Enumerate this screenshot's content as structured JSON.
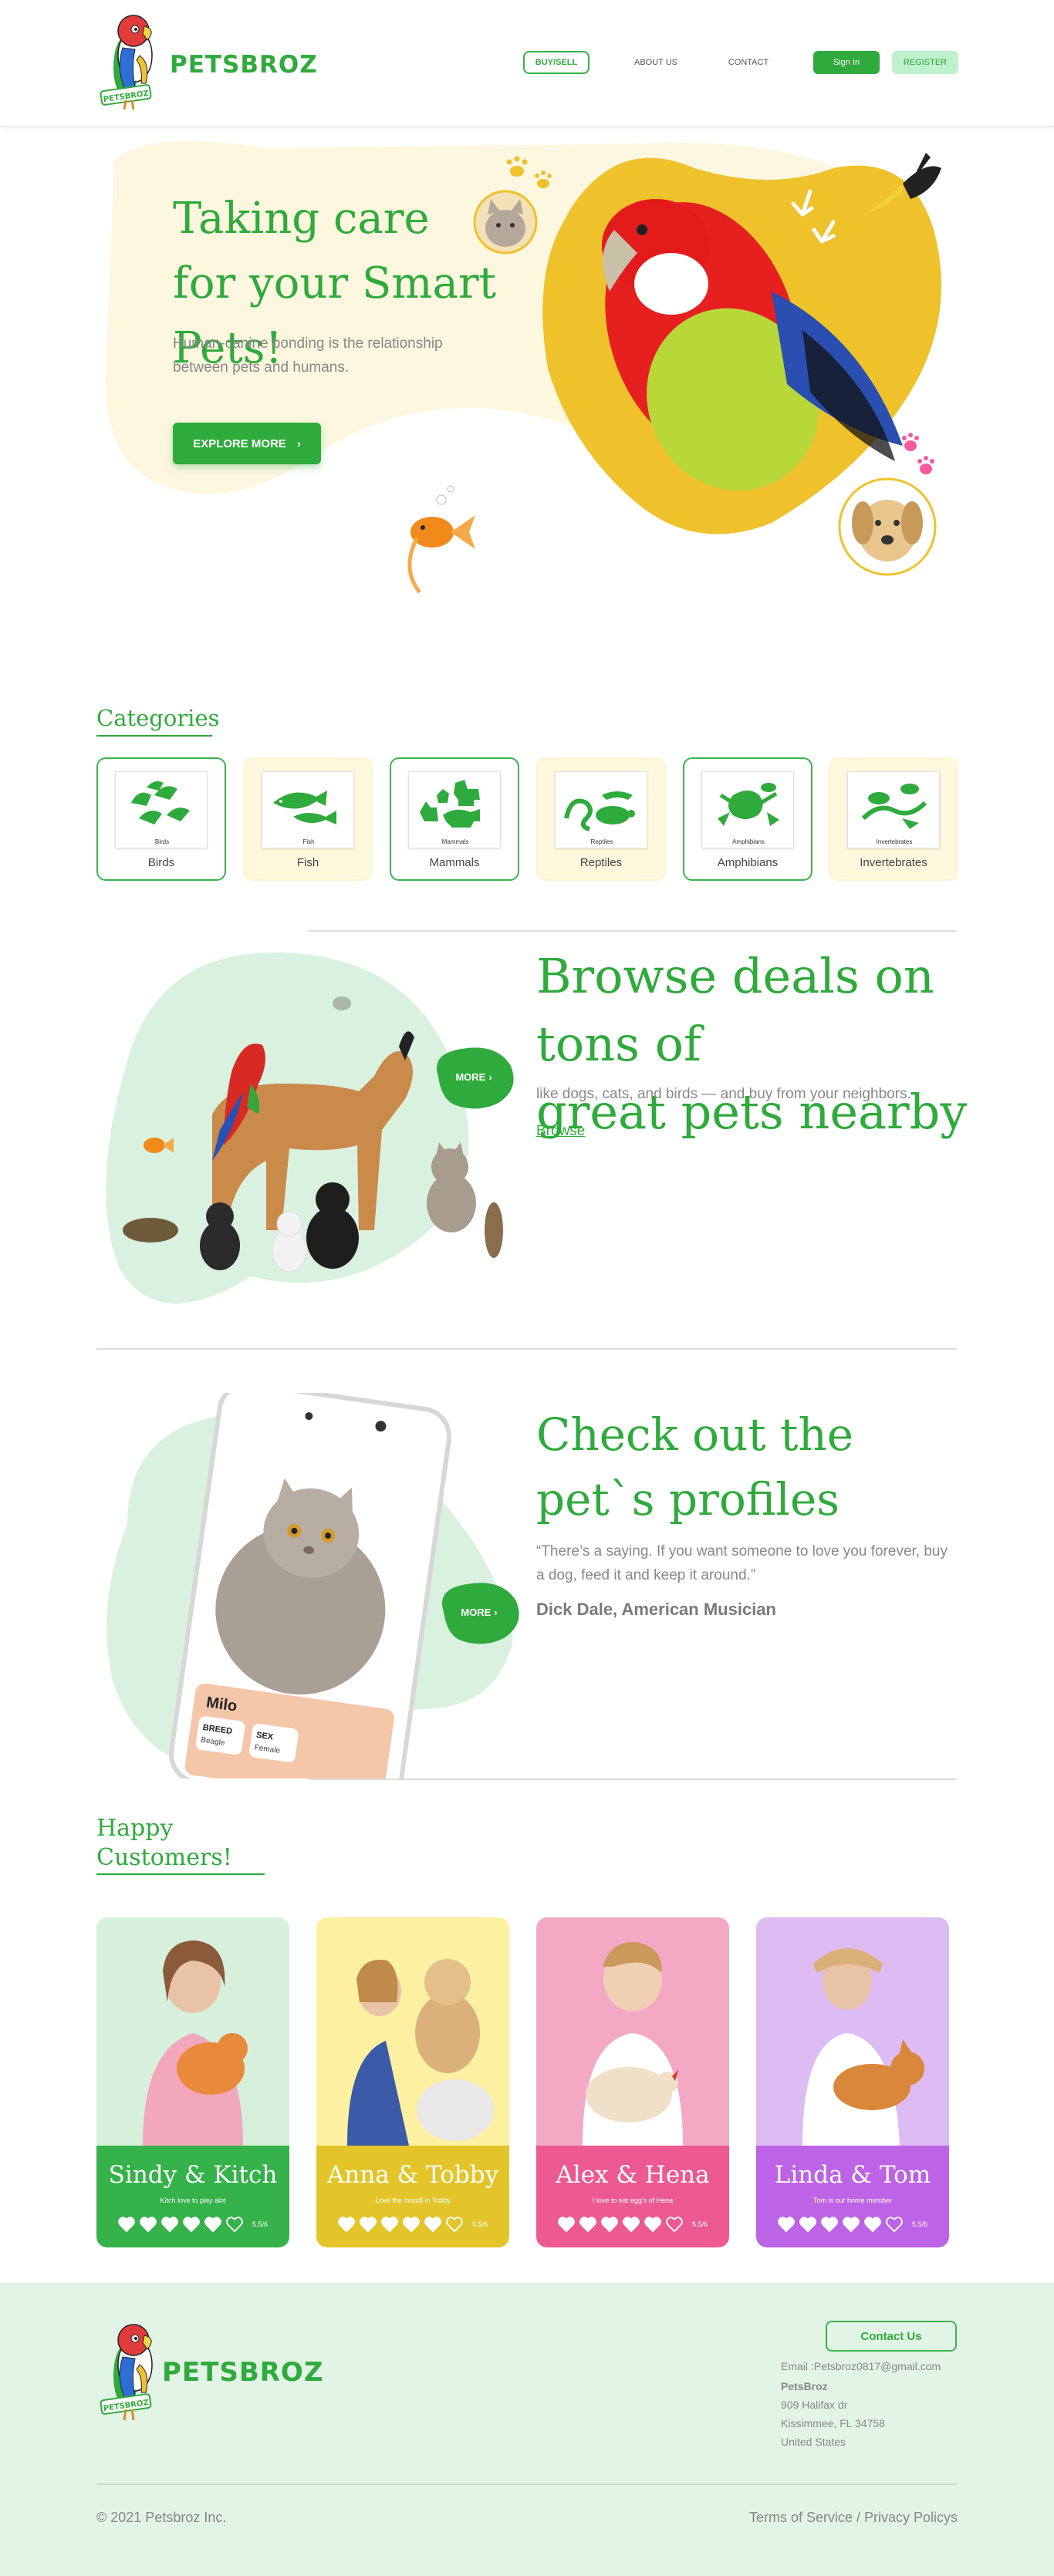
{
  "brand": {
    "name": "PETSBROZ",
    "logo_badge": "PETSBROZ",
    "primary_color": "#2faa3c",
    "accent_yellow": "#f0c030"
  },
  "nav": {
    "buy_sell": "BUY/SELL",
    "about": "ABOUT US",
    "contact": "CONTACT",
    "sign_in": "Sign In",
    "register": "REGISTER"
  },
  "hero": {
    "title_line1": "Taking care",
    "title_line2": "for your Smart Pets!",
    "description": "Human-canine bonding is the relationship between pets and humans.",
    "cta": "EXPLORE MORE",
    "cta_icon": "chevron-right-icon"
  },
  "categories": {
    "title": "Categories",
    "items": [
      {
        "label": "Birds",
        "thumb_label": "Birds",
        "icon": "birds-icon"
      },
      {
        "label": "Fish",
        "thumb_label": "Fish",
        "icon": "fish-icon"
      },
      {
        "label": "Mammals",
        "thumb_label": "Mammals",
        "icon": "mammals-icon"
      },
      {
        "label": "Reptiles",
        "thumb_label": "Reptiles",
        "icon": "reptiles-icon"
      },
      {
        "label": "Amphibians",
        "thumb_label": "Amphibians",
        "icon": "amphibians-icon"
      },
      {
        "label": "Invertebrates",
        "thumb_label": "Invertebrates",
        "icon": "invertebrates-icon"
      }
    ]
  },
  "browse": {
    "title_line1": "Browse deals on tons of",
    "title_line2": "great pets nearby",
    "description": "like dogs, cats, and birds — and buy from your neighbors.",
    "link": "Browse",
    "more": "MORE"
  },
  "profiles": {
    "title_line1": "Check out the",
    "title_line2": "pet`s profiles",
    "quote": "“There’s a saying. If you want someone to love you forever, buy a dog, feed it and keep it around.”",
    "author": "Dick Dale, American Musician",
    "more": "MORE",
    "phone": {
      "pet_name": "Milo",
      "breed_label": "BREED",
      "breed_value": "Beagle",
      "sex_label": "SEX",
      "sex_value": "Female"
    }
  },
  "customers": {
    "title_line1": "Happy",
    "title_line2": "Customers!",
    "items": [
      {
        "name": "Sindy & Kitch",
        "note": "Kitch love to play alot",
        "rating": 5,
        "score": "5.5/6",
        "photo_bg": "#d6f0dc",
        "band": "#35b24a"
      },
      {
        "name": "Anna & Tobby",
        "note": "Love the moodl in Tobby",
        "rating": 5,
        "score": "5.5/6",
        "photo_bg": "#fdf0a0",
        "band": "#e3c52a"
      },
      {
        "name": "Alex & Hena",
        "note": "I love to eat egg's of Hena",
        "rating": 5,
        "score": "5.5/6",
        "photo_bg": "#f3a9c4",
        "band": "#ec5a91"
      },
      {
        "name": "Linda & Tom",
        "note": "Tom is our home member",
        "rating": 5,
        "score": "5.5/6",
        "photo_bg": "#dcbcf2",
        "band": "#bd63e6"
      }
    ]
  },
  "footer": {
    "brand": "PETSBROZ",
    "contact_button": "Contact Us",
    "email": "Email :Petsbroz0817@gmail.com",
    "company": "PetsBroz",
    "address_lines": [
      "909 Halifax dr",
      "Kissimmee, FL 34758",
      "United States"
    ],
    "copyright": "© 2021 Petsbroz Inc.",
    "links": "Terms of Service / Privacy Policys"
  }
}
